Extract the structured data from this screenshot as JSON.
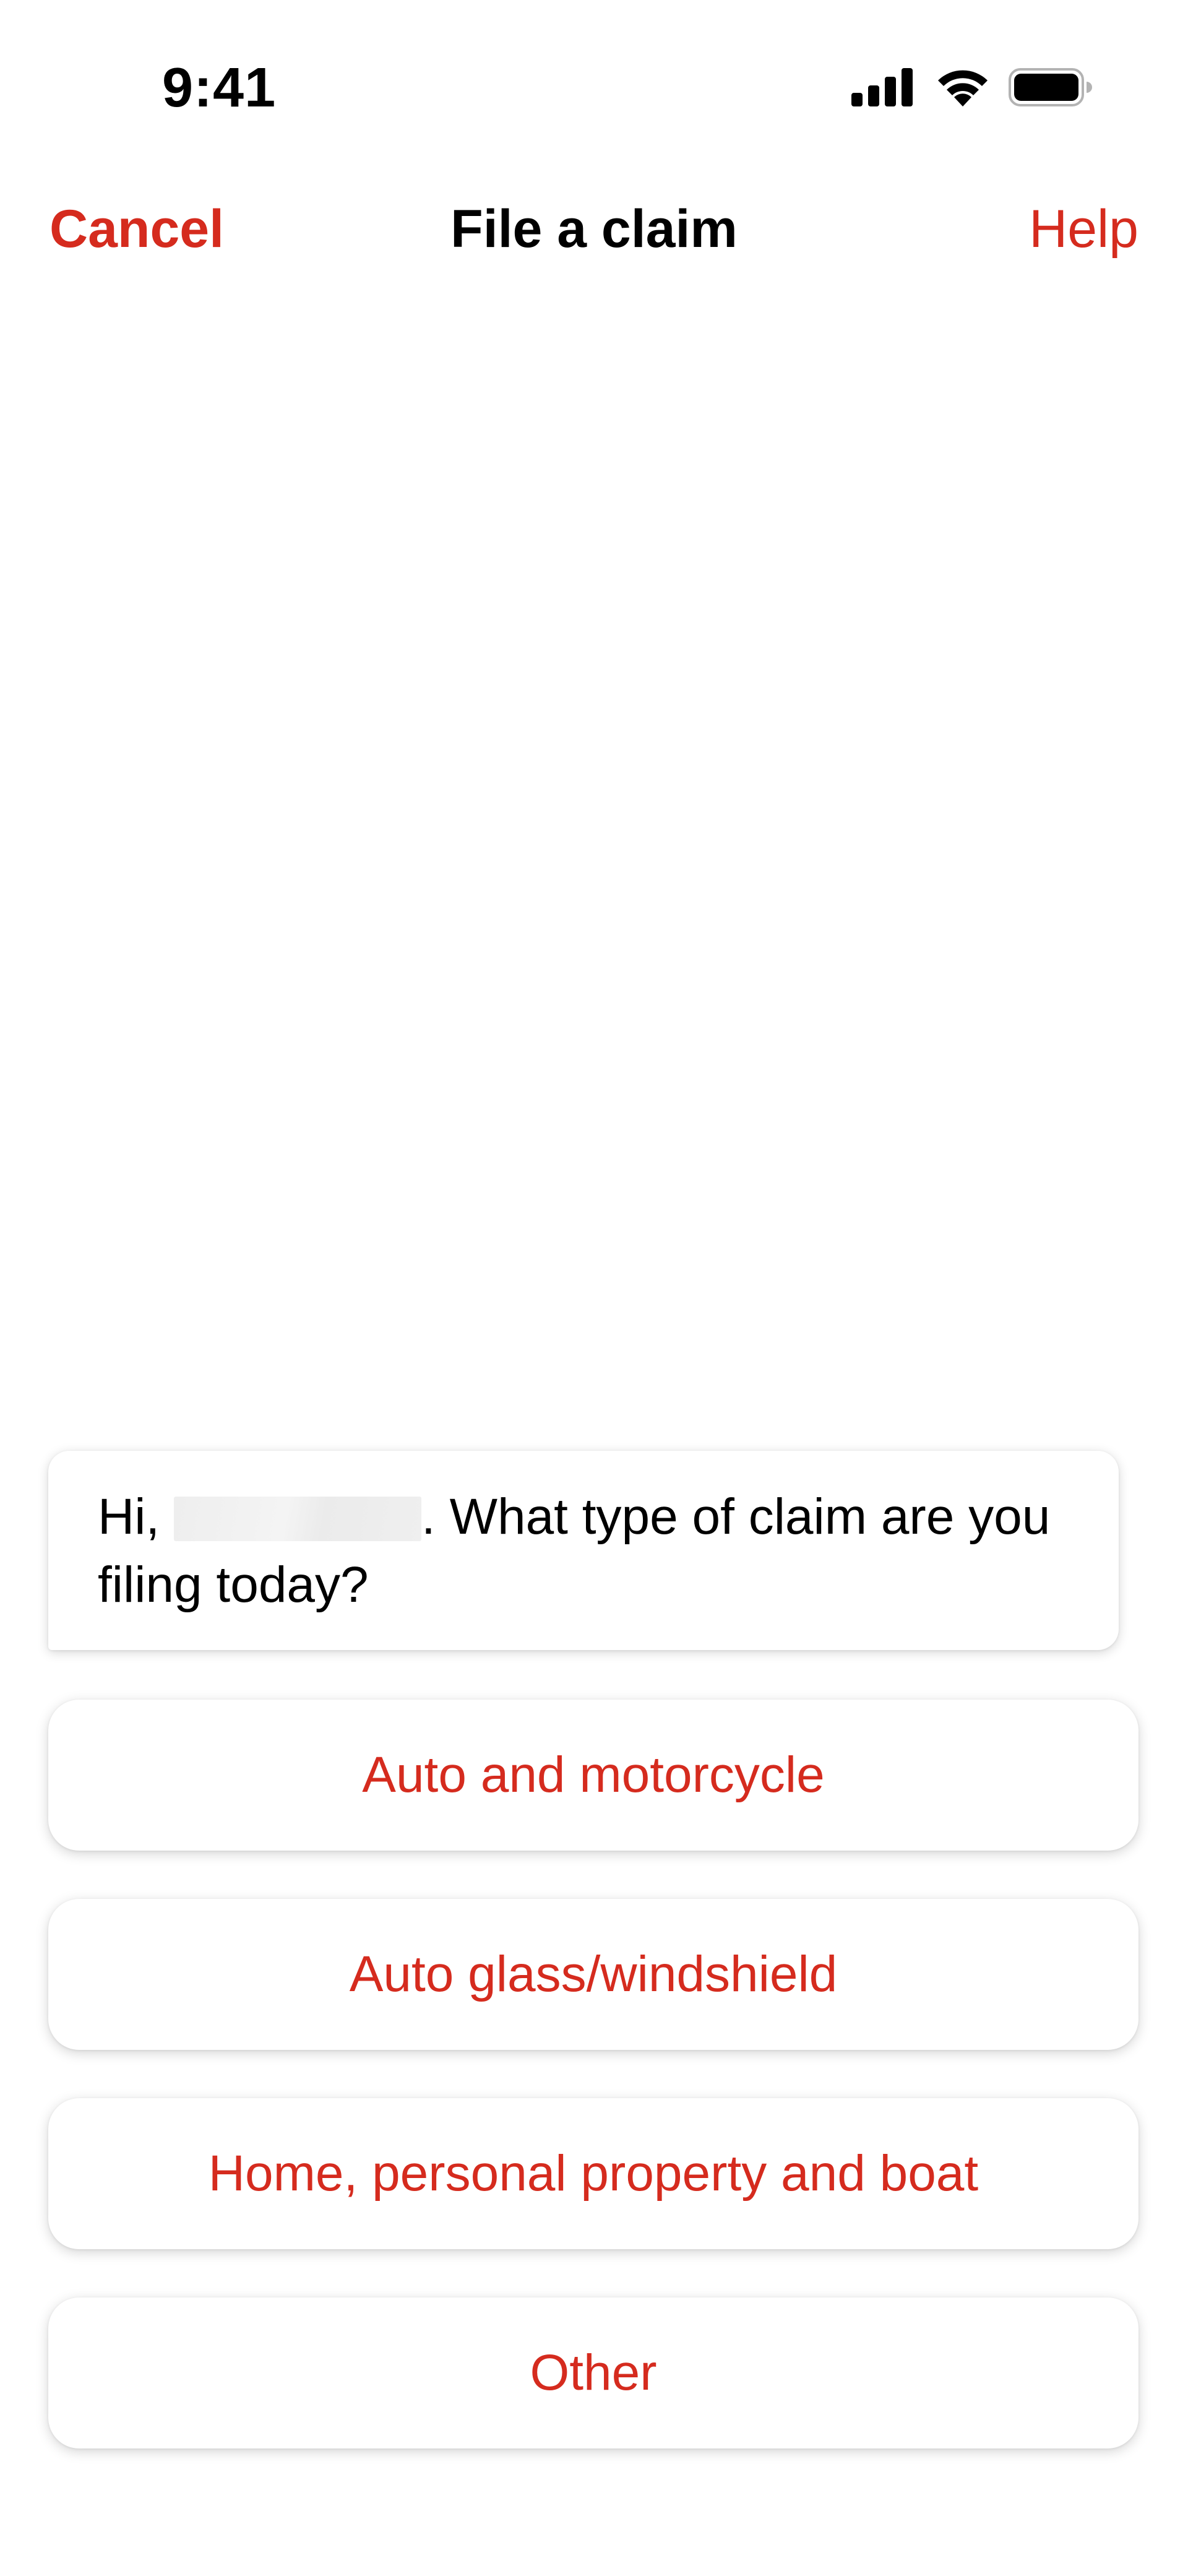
{
  "colors": {
    "accent": "#d52b1e",
    "background": "#ffffff",
    "text": "#000000"
  },
  "status_bar": {
    "time": "9:41",
    "icons": [
      "cellular-signal-icon",
      "wifi-icon",
      "battery-icon"
    ]
  },
  "nav": {
    "cancel_label": "Cancel",
    "title": "File a claim",
    "help_label": "Help"
  },
  "chat": {
    "greeting_prefix": "Hi,",
    "greeting_suffix": ". What type of claim are you filing today?"
  },
  "options": [
    {
      "label": "Auto and motorcycle"
    },
    {
      "label": "Auto glass/windshield"
    },
    {
      "label": "Home, personal property and boat"
    },
    {
      "label": "Other"
    }
  ]
}
